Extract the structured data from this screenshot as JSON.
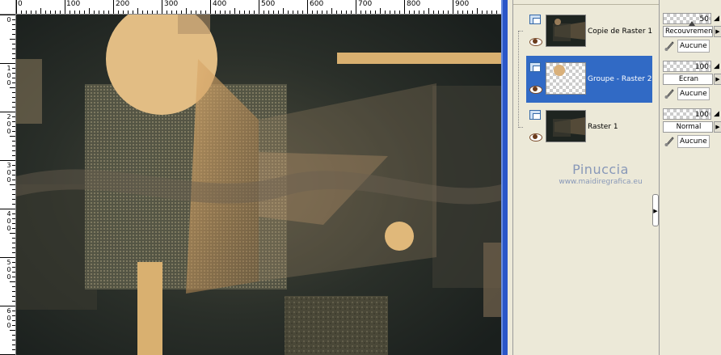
{
  "rulers": {
    "horizontal": [
      "0",
      "100",
      "200",
      "300",
      "400",
      "500",
      "600",
      "700",
      "800",
      "900"
    ],
    "vertical": [
      "0",
      "1\n0\n0",
      "2\n0\n0",
      "3\n0\n0",
      "4\n0\n0",
      "5\n0\n0",
      "6\n0\n0"
    ]
  },
  "layers": [
    {
      "name": "Copie de Raster 1",
      "visible": true,
      "selected": false,
      "thumb": "dark-scene"
    },
    {
      "name": "Groupe - Raster 2",
      "visible": true,
      "selected": true,
      "thumb": "transparent-circle"
    },
    {
      "name": "Raster 1",
      "visible": true,
      "selected": false,
      "thumb": "dark-scene"
    }
  ],
  "properties": [
    {
      "opacity": "50",
      "blend": "Recouvrement",
      "mask": "Aucune"
    },
    {
      "opacity": "100",
      "blend": "Ecran",
      "mask": "Aucune"
    },
    {
      "opacity": "100",
      "blend": "Normal",
      "mask": "Aucune"
    }
  ],
  "watermark": {
    "name": "Pinuccia",
    "site": "www.maidiregrafica.eu"
  },
  "colors": {
    "selection": "#316ac5",
    "canvas_border": "#2a56c8",
    "panel_bg": "#ece9d8",
    "watermark": "#8898b8",
    "art_dark": "#1f2420",
    "art_gold": "#d4a866"
  }
}
